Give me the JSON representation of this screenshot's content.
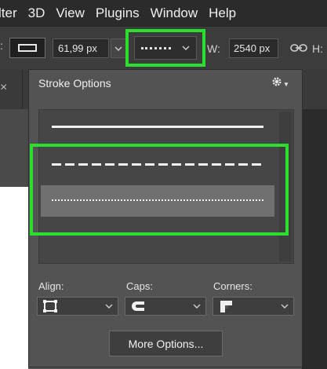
{
  "menu": {
    "items": [
      "lter",
      "3D",
      "View",
      "Plugins",
      "Window",
      "Help"
    ]
  },
  "options_bar": {
    "leading_colon": ":",
    "stroke_width": "61,99 px",
    "w_label": "W:",
    "w_value": "2540 px",
    "h_label": "H:"
  },
  "tabs": {
    "close_glyph": "×"
  },
  "popup": {
    "title": "Stroke Options",
    "stroke_styles": [
      "solid",
      "dashed",
      "dotted"
    ],
    "selected_style": "dotted",
    "align_label": "Align:",
    "caps_label": "Caps:",
    "corners_label": "Corners:",
    "more_button": "More Options..."
  },
  "colors": {
    "highlight": "#29e02e",
    "panel": "#535353",
    "menubar": "#2b2b2b"
  }
}
